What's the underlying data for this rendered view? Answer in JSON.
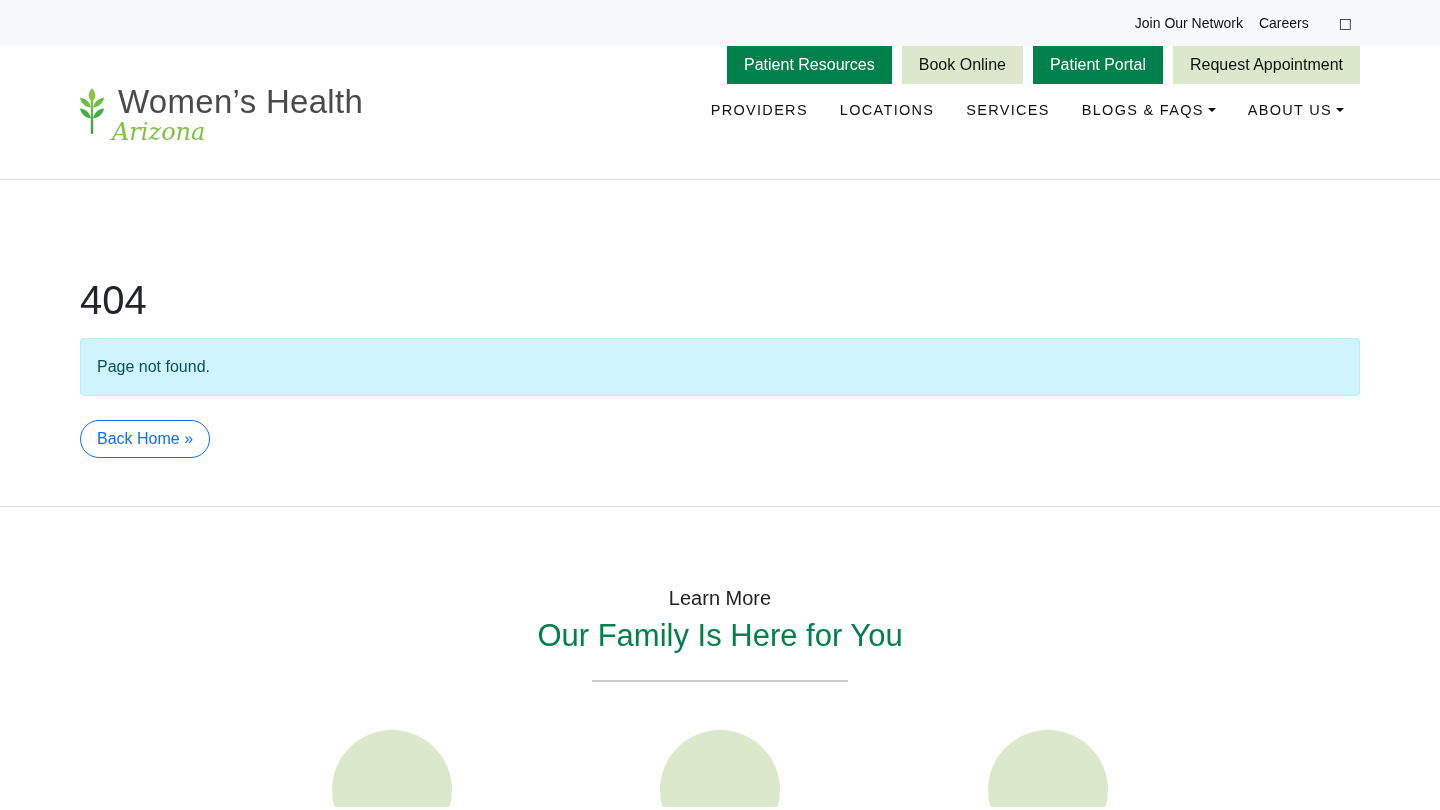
{
  "top_bar": {
    "links": [
      "Join Our Network",
      "Careers"
    ],
    "icon_glyph": "□"
  },
  "logo": {
    "name": "Women’s Health",
    "region": "Arizona"
  },
  "action_buttons": [
    {
      "label": "Patient Resources",
      "kind": "primary"
    },
    {
      "label": "Book Online",
      "kind": "light"
    },
    {
      "label": "Patient Portal",
      "kind": "primary"
    },
    {
      "label": "Request Appointment",
      "kind": "light"
    }
  ],
  "nav": [
    {
      "label": "PROVIDERS",
      "dropdown": false
    },
    {
      "label": "LOCATIONS",
      "dropdown": false
    },
    {
      "label": "SERVICES",
      "dropdown": false
    },
    {
      "label": "BLOGS & FAQS",
      "dropdown": true
    },
    {
      "label": "ABOUT US",
      "dropdown": true
    }
  ],
  "error": {
    "code": "404",
    "message": "Page not found.",
    "button": "Back Home »"
  },
  "learn_more": {
    "eyebrow": "Learn More",
    "heading": "Our Family Is Here for You",
    "items": [
      {
        "kind": "circle"
      },
      {
        "kind": "circle"
      },
      {
        "kind": "circle"
      }
    ]
  }
}
